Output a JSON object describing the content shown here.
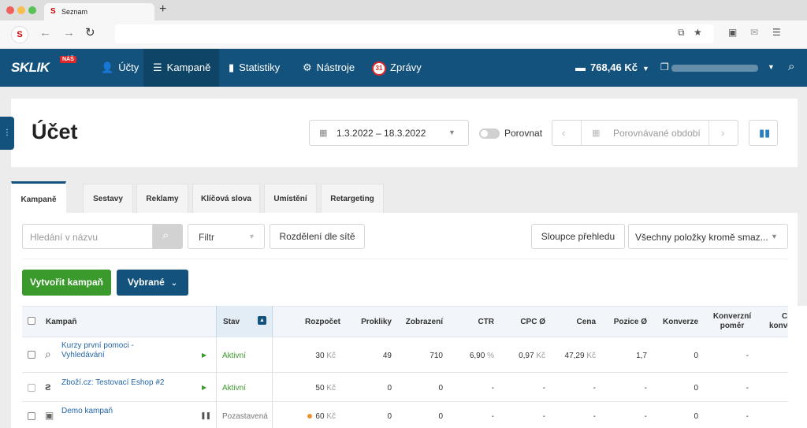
{
  "browser": {
    "tab_title": "Seznam",
    "favicon": "S",
    "new_tab": "+",
    "nav_icon_logo": "S"
  },
  "header": {
    "logo": "SKLIK",
    "logo_badge": "NÁŠ",
    "menu": [
      {
        "label": "Účty",
        "icon": "users-icon"
      },
      {
        "label": "Kampaně",
        "icon": "list-icon"
      },
      {
        "label": "Statistiky",
        "icon": "bar-chart-icon"
      },
      {
        "label": "Nástroje",
        "icon": "gear-icon"
      },
      {
        "label": "Zprávy",
        "icon": "messages-icon",
        "badge": "31"
      }
    ],
    "balance": "768,46 Kč",
    "accent": "#12527c"
  },
  "page": {
    "title": "Účet",
    "date_range": "1.3.2022 – 18.3.2022",
    "compare_label": "Porovnat",
    "compare_placeholder": "Porovnávané období"
  },
  "tabs": [
    "Kampaně",
    "Sestavy",
    "Reklamy",
    "Klíčová slova",
    "Umístění",
    "Retargeting"
  ],
  "toolbar": {
    "search_placeholder": "Hledání v názvu",
    "filter_label": "Filtr",
    "split_label": "Rozdělení dle sítě",
    "columns_label": "Sloupce přehledu",
    "items_select": "Všechny položky kromě smaz...",
    "create_label": "Vytvořit kampaň",
    "selected_label": "Vybrané"
  },
  "table": {
    "headers": {
      "campaign": "Kampaň",
      "status": "Stav",
      "budget": "Rozpočet",
      "clicks": "Prokliky",
      "impressions": "Zobrazení",
      "ctr": "CTR",
      "cpc": "CPC Ø",
      "price": "Cena",
      "position": "Pozice Ø",
      "conversions": "Konverze",
      "conv_ratio_1": "Konverzní",
      "conv_ratio_2": "poměr",
      "cut_1": "C",
      "cut_2": "konve"
    },
    "rows": [
      {
        "name_1": "Kurzy první pomoci -",
        "name_2": "Vyhledávání",
        "status": "Aktivní",
        "budget": "30",
        "currency": "Kč",
        "clicks": "49",
        "impressions": "710",
        "ctr": "6,90",
        "ctr_unit": "%",
        "cpc": "0,97",
        "price": "47,29",
        "position": "1,7",
        "conversions": "0",
        "conv_ratio": "-"
      },
      {
        "name_1": "Zboží.cz: Testovací Eshop #2",
        "name_2": "",
        "status": "Aktivní",
        "budget": "50",
        "currency": "Kč",
        "clicks": "0",
        "impressions": "0",
        "ctr": "-",
        "ctr_unit": "",
        "cpc": "-",
        "price": "-",
        "position": "-",
        "conversions": "0",
        "conv_ratio": "-"
      },
      {
        "name_1": "Demo kampaň",
        "name_2": "",
        "status": "Pozastavená",
        "budget": "60",
        "currency": "Kč",
        "clicks": "0",
        "impressions": "0",
        "ctr": "-",
        "ctr_unit": "",
        "cpc": "-",
        "price": "-",
        "position": "-",
        "conversions": "0",
        "conv_ratio": "-"
      }
    ]
  }
}
